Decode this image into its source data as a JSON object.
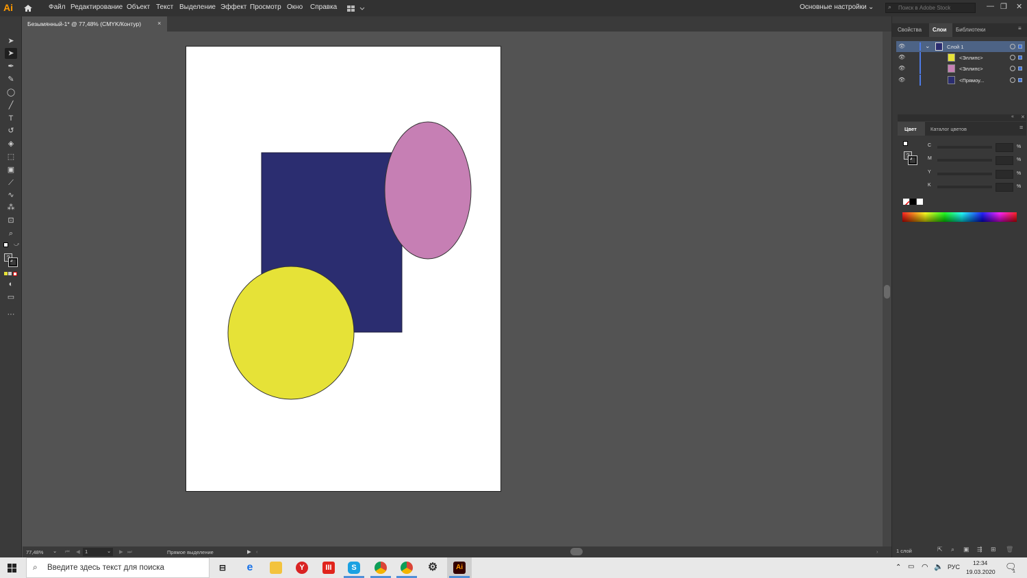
{
  "app": {
    "logo": "Ai"
  },
  "menu": [
    "Файл",
    "Редактирование",
    "Объект",
    "Текст",
    "Выделение",
    "Эффект",
    "Просмотр",
    "Окно",
    "Справка"
  ],
  "workspace": "Основные настройки",
  "stock_search": {
    "placeholder": "Поиск в Adobe Stock"
  },
  "document_tab": {
    "title": "Безымянный-1* @ 77,48% (CMYK/Контур)",
    "close": "×"
  },
  "canvas": {
    "shapes": [
      {
        "name": "rectangle",
        "fill": "#2b2d70"
      },
      {
        "name": "ellipse-pink",
        "fill": "#c67fb4"
      },
      {
        "name": "ellipse-yellow",
        "fill": "#e6e237"
      }
    ]
  },
  "status": {
    "zoom": "77,48%",
    "artboard": "1",
    "tool": "Прямое выделение"
  },
  "panels": {
    "tabs": [
      "Свойства",
      "Слои",
      "Библиотеки"
    ],
    "layers": [
      {
        "name": "Слой 1",
        "swatch": "#2b2d70"
      },
      {
        "name": "<Эллипс>",
        "swatch": "#e6e237"
      },
      {
        "name": "<Эллипс>",
        "swatch": "#c67fb4"
      },
      {
        "name": "<Прямоу...",
        "swatch": "#2b2d70"
      }
    ],
    "layers_count": "1 слой",
    "color_tabs": [
      "Цвет",
      "Каталог цветов"
    ],
    "cmyk": [
      {
        "label": "C",
        "unit": "%"
      },
      {
        "label": "M",
        "unit": "%"
      },
      {
        "label": "Y",
        "unit": "%"
      },
      {
        "label": "K",
        "unit": "%"
      }
    ]
  },
  "taskbar": {
    "search": "Введите здесь текст для поиска",
    "lang": "РУС",
    "time": "12:34",
    "date": "19.03.2020",
    "notif": "1"
  }
}
